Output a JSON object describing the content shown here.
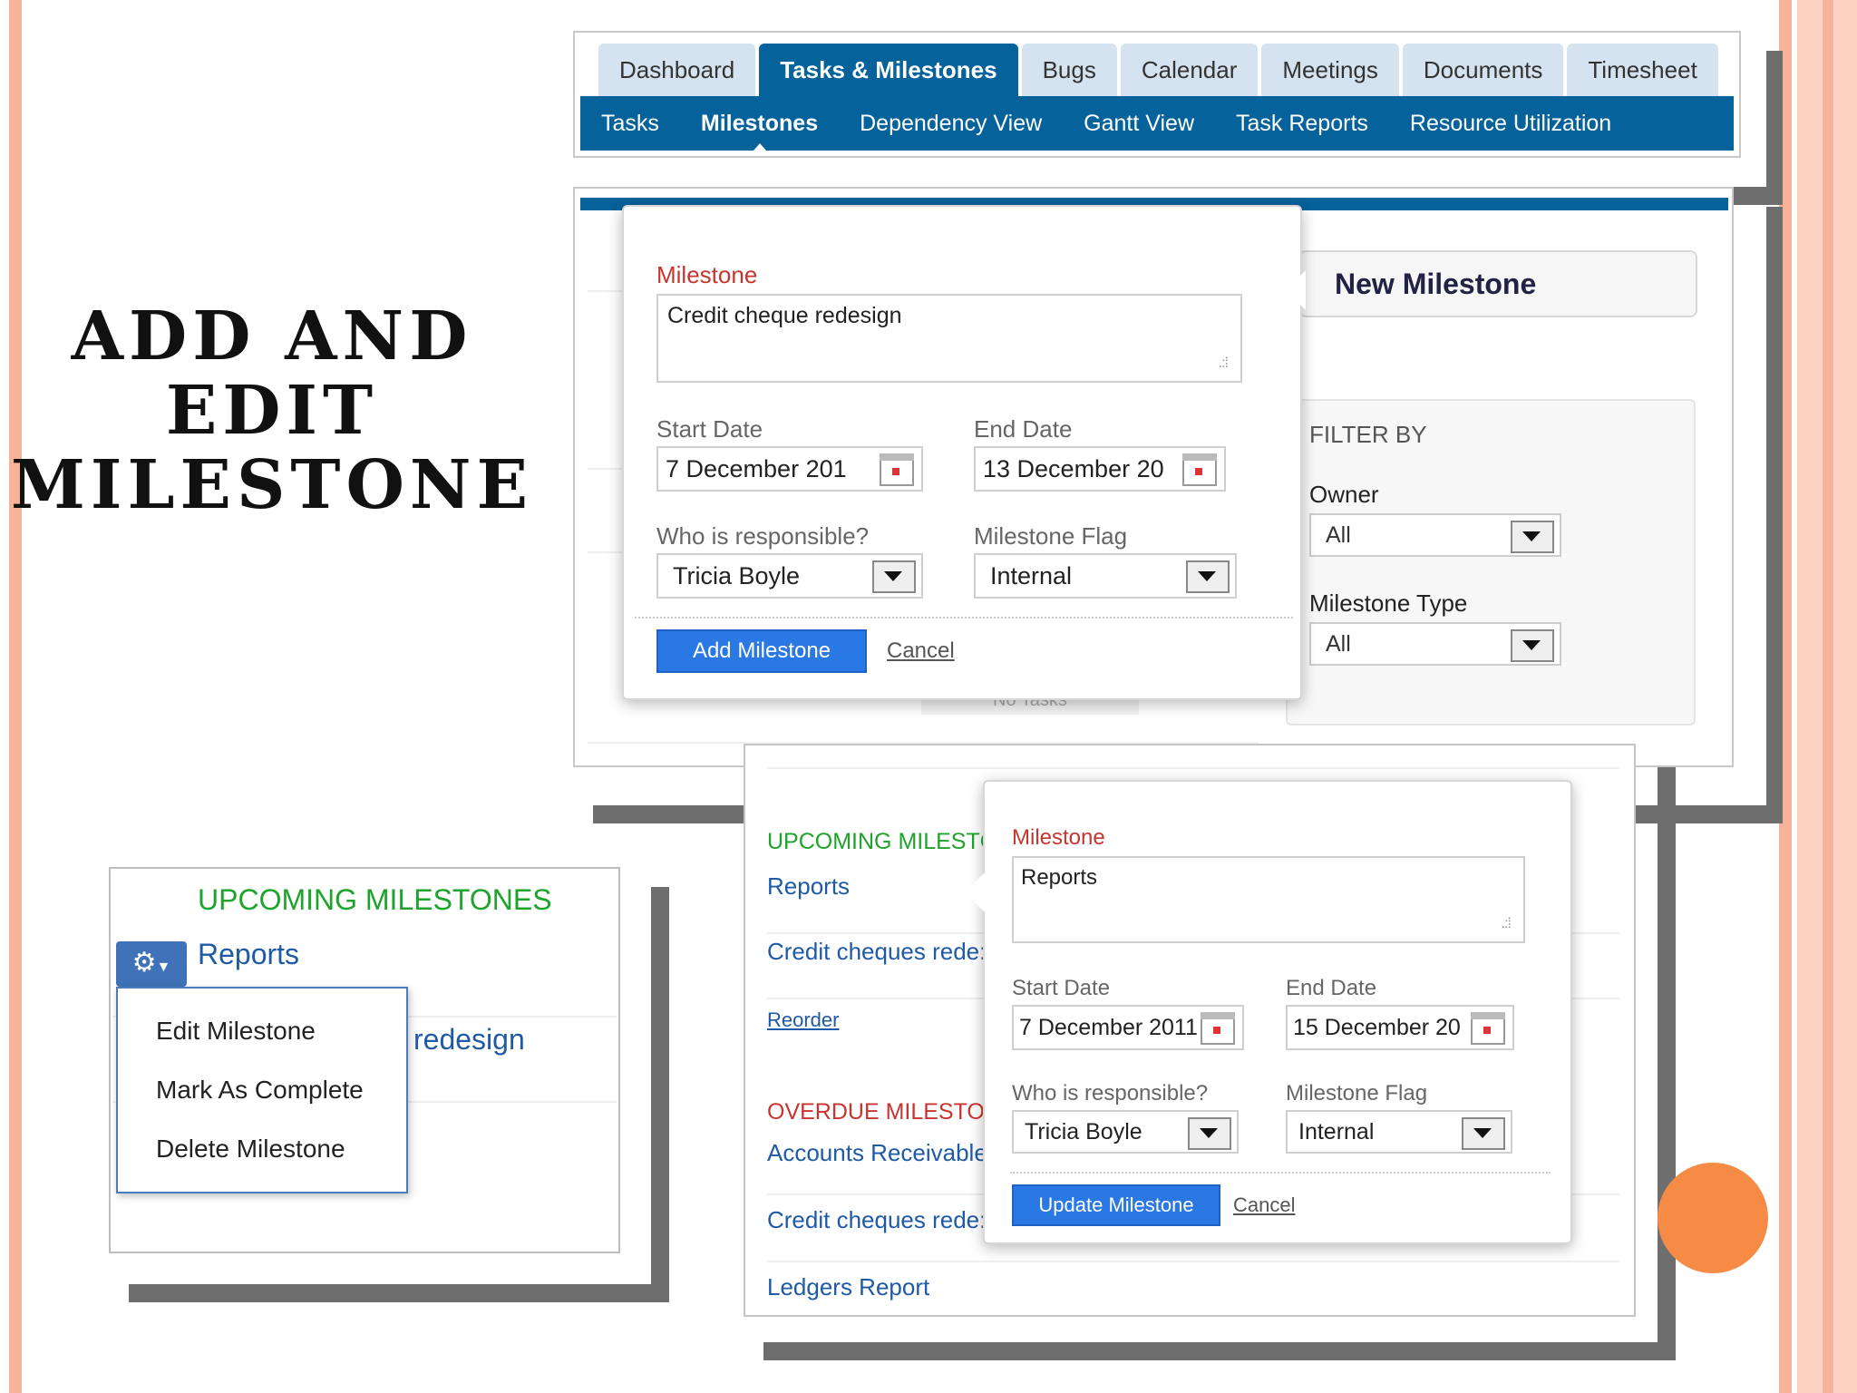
{
  "slide": {
    "title_lines": [
      "ADD AND",
      "EDIT",
      "MILESTONE"
    ]
  },
  "nav": {
    "tabs": [
      {
        "label": "Dashboard"
      },
      {
        "label": "Tasks & Milestones"
      },
      {
        "label": "Bugs"
      },
      {
        "label": "Calendar"
      },
      {
        "label": "Meetings"
      },
      {
        "label": "Documents"
      },
      {
        "label": "Timesheet"
      }
    ],
    "active_tab": "Tasks & Milestones",
    "subtabs": [
      {
        "label": "Tasks"
      },
      {
        "label": "Milestones"
      },
      {
        "label": "Dependency View"
      },
      {
        "label": "Gantt View"
      },
      {
        "label": "Task Reports"
      },
      {
        "label": "Resource Utilization"
      }
    ],
    "active_subtab": "Milestones"
  },
  "add_panel": {
    "new_milestone_button": "New Milestone",
    "filter": {
      "title": "FILTER BY",
      "owner_label": "Owner",
      "owner_value": "All",
      "type_label": "Milestone Type",
      "type_value": "All"
    },
    "no_tasks": "No Tasks",
    "form": {
      "milestone_label": "Milestone",
      "milestone_value": "Credit cheque redesign",
      "start_label": "Start Date",
      "start_value": "7 December 201",
      "end_label": "End Date",
      "end_value": "13 December 20",
      "responsible_label": "Who is responsible?",
      "responsible_value": "Tricia Boyle",
      "flag_label": "Milestone Flag",
      "flag_value": "Internal",
      "submit": "Add Milestone",
      "cancel": "Cancel"
    }
  },
  "context_card": {
    "heading": "UPCOMING MILESTONES",
    "item": "Reports",
    "partial_item": "redesign",
    "menu": [
      "Edit Milestone",
      "Mark As Complete",
      "Delete Milestone"
    ]
  },
  "update_panel": {
    "upcoming_heading": "UPCOMING MILESTC",
    "upcoming_items": [
      "Reports",
      "Credit cheques rede:"
    ],
    "reorder_link": "Reorder",
    "overdue_heading": "OVERDUE MILESTO",
    "overdue_items": [
      "Accounts Receivable",
      "Credit cheques rede:",
      "Ledgers Report"
    ],
    "form": {
      "milestone_label": "Milestone",
      "milestone_value": "Reports",
      "start_label": "Start Date",
      "start_value": "7 December 2011",
      "end_label": "End Date",
      "end_value": "15 December 20",
      "responsible_label": "Who is responsible?",
      "responsible_value": "Tricia Boyle",
      "flag_label": "Milestone Flag",
      "flag_value": "Internal",
      "submit": "Update Milestone",
      "cancel": "Cancel"
    }
  },
  "colors": {
    "nav_blue": "#06629a",
    "tab_light": "#d4e3ef",
    "button_blue": "#2a78e4",
    "milestone_red": "#c8352e",
    "upcoming_green": "#1ea32c",
    "overdue_red": "#c8352e",
    "link_blue": "#1f5aa6",
    "slide_accent": "#f6b39c",
    "orange_dot": "#f58b45"
  }
}
